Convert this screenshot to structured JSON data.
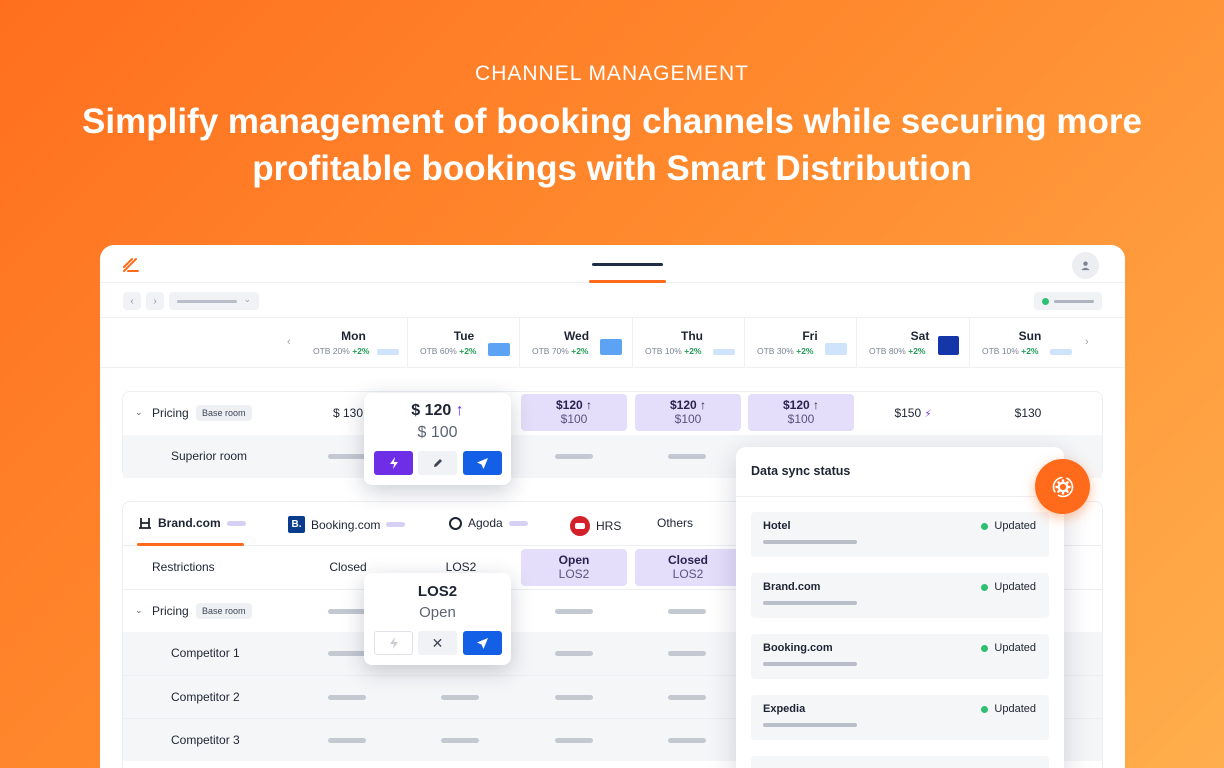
{
  "hero": {
    "eyebrow": "CHANNEL MANAGEMENT",
    "title": "Simplify management of booking channels while securing more profitable bookings with Smart Distribution"
  },
  "colors": {
    "accent": "#ff6b1a",
    "primary_blue": "#1360e6",
    "purple": "#6d2ee6",
    "status_green": "#2fbf71"
  },
  "days": [
    {
      "name": "Mon",
      "otb": "OTB 20%",
      "delta": "+2%"
    },
    {
      "name": "Tue",
      "otb": "OTB 60%",
      "delta": "+2%"
    },
    {
      "name": "Wed",
      "otb": "OTB 70%",
      "delta": "+2%"
    },
    {
      "name": "Thu",
      "otb": "OTB 10%",
      "delta": "+2%"
    },
    {
      "name": "Fri",
      "otb": "OTB 30%",
      "delta": "+2%"
    },
    {
      "name": "Sat",
      "otb": "OTB 80%",
      "delta": "+2%"
    },
    {
      "name": "Sun",
      "otb": "OTB 10%",
      "delta": "+2%"
    }
  ],
  "pricing_panel": {
    "label": "Pricing",
    "tag": "Base room",
    "mon": "$ 130",
    "wed": {
      "top": "$120",
      "bottom": "$100"
    },
    "thu": {
      "top": "$120",
      "bottom": "$100"
    },
    "fri": {
      "top": "$120",
      "bottom": "$100"
    },
    "sat": "$150",
    "sun": "$130",
    "sub_row": "Superior room"
  },
  "price_popup": {
    "new_price": "$ 120",
    "old_price": "$ 100"
  },
  "channels": [
    "Brand.com",
    "Booking.com",
    "Agoda",
    "HRS",
    "Others"
  ],
  "restrictions": {
    "label": "Restrictions",
    "mon": "Closed",
    "tue": "LOS2",
    "wed": {
      "top": "Open",
      "bottom": "LOS2"
    },
    "thu": {
      "top": "Closed",
      "bottom": "LOS2"
    }
  },
  "pricing2": {
    "label": "Pricing",
    "tag": "Base room"
  },
  "competitors": [
    "Competitor 1",
    "Competitor 2",
    "Competitor 3"
  ],
  "los_popup": {
    "title": "LOS2",
    "subtitle": "Open"
  },
  "sync": {
    "title": "Data sync status",
    "items": [
      {
        "name": "Hotel",
        "status": "Updated"
      },
      {
        "name": "Brand.com",
        "status": "Updated"
      },
      {
        "name": "Booking.com",
        "status": "Updated"
      },
      {
        "name": "Expedia",
        "status": "Updated"
      }
    ]
  }
}
